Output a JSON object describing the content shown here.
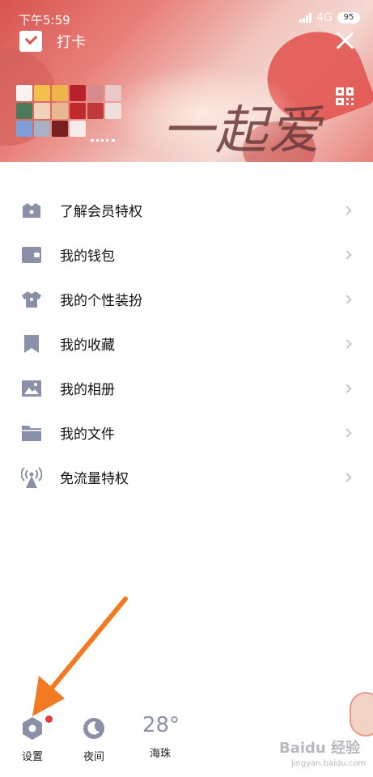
{
  "status_bar": {
    "time": "下午5:59",
    "network": "4G",
    "battery": "95"
  },
  "header": {
    "checkin_label": "打卡",
    "banner_text": "一起爱"
  },
  "menu": {
    "items": [
      {
        "label": "了解会员特权",
        "icon": "crown-icon"
      },
      {
        "label": "我的钱包",
        "icon": "wallet-icon"
      },
      {
        "label": "我的个性装扮",
        "icon": "shirt-icon"
      },
      {
        "label": "我的收藏",
        "icon": "bookmark-icon"
      },
      {
        "label": "我的相册",
        "icon": "photo-icon"
      },
      {
        "label": "我的文件",
        "icon": "folder-icon"
      },
      {
        "label": "免流量特权",
        "icon": "signal-tower-icon"
      }
    ]
  },
  "bottom_bar": {
    "settings_label": "设置",
    "night_label": "夜间",
    "temperature": "28°",
    "city": "海珠"
  },
  "watermark": {
    "brand": "Baidu 经验",
    "url": "jingyan.baidu.com"
  },
  "colors": {
    "icon": "#8a90a8",
    "badge": "#e43b3b",
    "arrow": "#f27a22"
  }
}
